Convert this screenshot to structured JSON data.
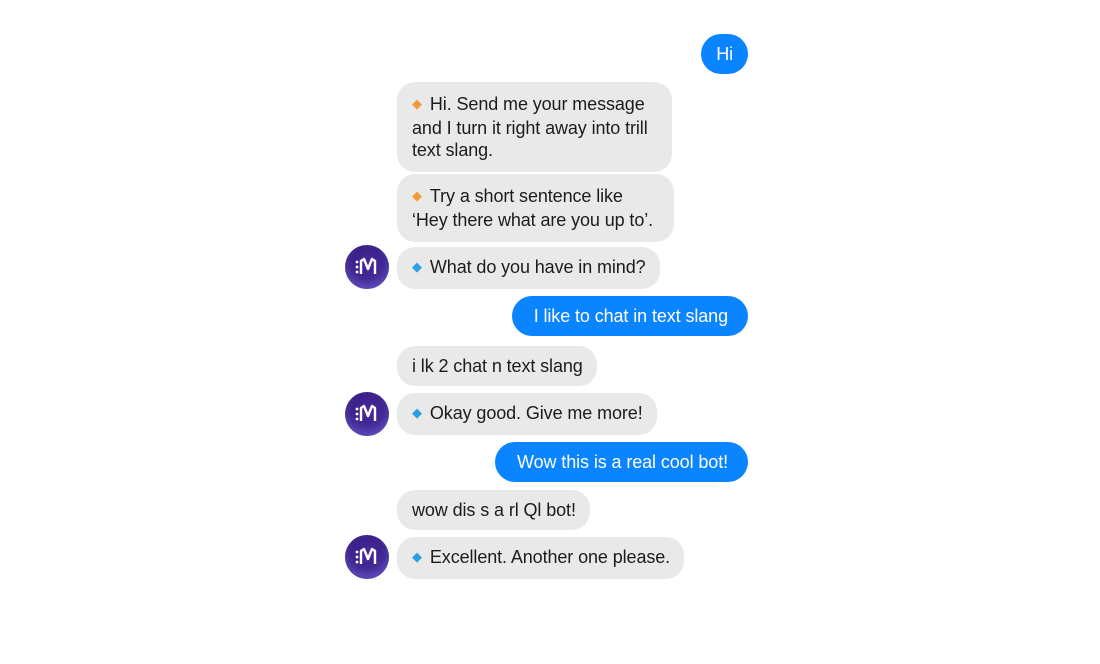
{
  "conversation": {
    "messages": [
      {
        "sender": "user",
        "text": "Hi"
      },
      {
        "sender": "bot",
        "marker": "orange-diamond-icon",
        "text": "Hi. Send me your message and I turn it right away into trill text slang."
      },
      {
        "sender": "bot",
        "marker": "orange-diamond-icon",
        "text": "Try a short sentence like ‘Hey there what are you up to’."
      },
      {
        "sender": "bot",
        "marker": "blue-diamond-icon",
        "text": "What do you have in mind?"
      },
      {
        "sender": "user",
        "text": "I like to chat in text slang"
      },
      {
        "sender": "bot",
        "text": "i lk 2 chat n text slang"
      },
      {
        "sender": "bot",
        "marker": "blue-diamond-icon",
        "text": "Okay good. Give me more!"
      },
      {
        "sender": "user",
        "text": "Wow this is a real cool bot!"
      },
      {
        "sender": "bot",
        "text": "wow dis s a rl Ql bot!"
      },
      {
        "sender": "bot",
        "marker": "blue-diamond-icon",
        "text": "Excellent. Another one please."
      }
    ]
  },
  "icons": {
    "diamond_glyph": "◆",
    "bot_avatar": "bot-avatar-icon"
  },
  "colors": {
    "user_bubble": "#0a84ff",
    "bot_bubble": "#e9e9e9",
    "orange_marker": "#f29a3a",
    "blue_marker": "#2e9ee6",
    "avatar": "#3a1f86"
  }
}
